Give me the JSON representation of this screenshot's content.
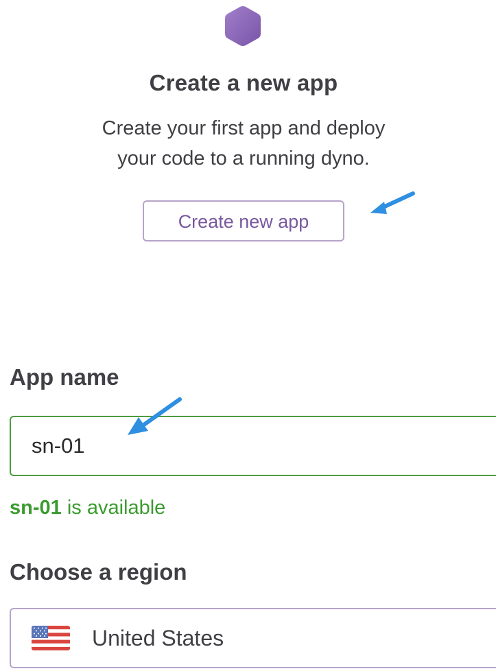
{
  "hero": {
    "title": "Create a new app",
    "description_line1": "Create your first app and deploy",
    "description_line2": "your code to a running dyno.",
    "create_button_label": "Create new app",
    "logo_icon": "hexagon-logo-icon"
  },
  "form": {
    "app_name_label": "App name",
    "app_name_value": "sn-01",
    "availability_name": "sn-01",
    "availability_text": " is available",
    "region_label": "Choose a region",
    "region_selected": "United States",
    "region_icon": "us-flag-icon"
  },
  "colors": {
    "accent_purple": "#79589f",
    "success_green": "#3a9b2e",
    "annotation_blue": "#2f8fe0"
  }
}
